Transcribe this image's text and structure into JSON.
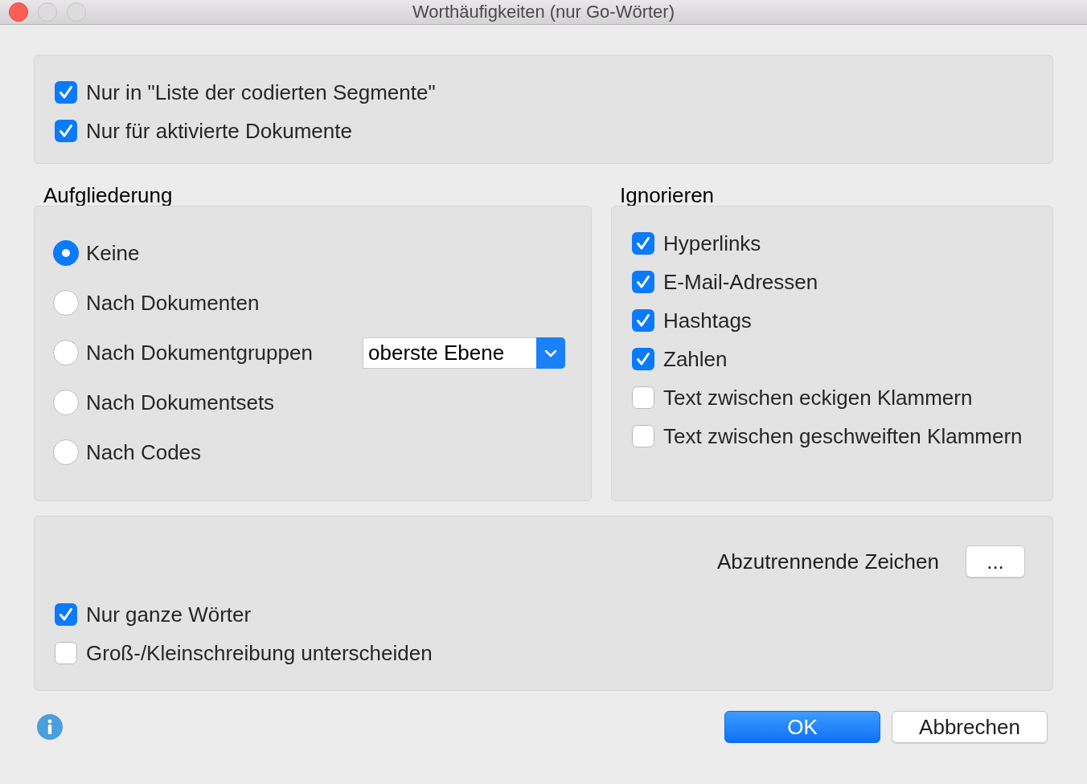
{
  "window": {
    "title": "Worthäufigkeiten (nur Go-Wörter)"
  },
  "scope_options": [
    {
      "label": "Nur in \"Liste der codierten Segmente\"",
      "checked": true
    },
    {
      "label": "Nur für aktivierte Dokumente",
      "checked": true
    }
  ],
  "breakdown": {
    "title": "Aufgliederung",
    "options": [
      {
        "label": "Keine",
        "selected": true
      },
      {
        "label": "Nach Dokumenten",
        "selected": false
      },
      {
        "label": "Nach Dokumentgruppen",
        "selected": false,
        "dropdown": {
          "value": "oberste Ebene"
        }
      },
      {
        "label": "Nach Dokumentsets",
        "selected": false
      },
      {
        "label": "Nach Codes",
        "selected": false
      }
    ]
  },
  "ignore": {
    "title": "Ignorieren",
    "options": [
      {
        "label": "Hyperlinks",
        "checked": true
      },
      {
        "label": "E-Mail-Adressen",
        "checked": true
      },
      {
        "label": "Hashtags",
        "checked": true
      },
      {
        "label": "Zahlen",
        "checked": true
      },
      {
        "label": "Text zwischen eckigen Klammern",
        "checked": false
      },
      {
        "label": "Text zwischen geschweiften Klammern",
        "checked": false
      }
    ]
  },
  "text_options": {
    "separator_label": "Abzutrennende Zeichen",
    "separator_button": "...",
    "options": [
      {
        "label": "Nur ganze Wörter",
        "checked": true
      },
      {
        "label": "Groß-/Kleinschreibung unterscheiden",
        "checked": false
      }
    ]
  },
  "buttons": [
    {
      "label": "OK",
      "kind": "primary"
    },
    {
      "label": "Abbrechen",
      "kind": "secondary"
    }
  ]
}
